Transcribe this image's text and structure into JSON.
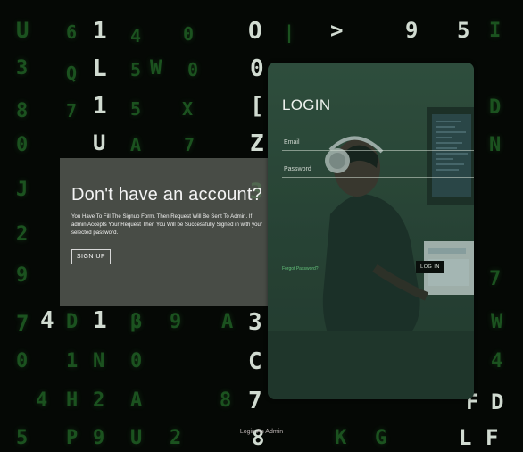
{
  "promo": {
    "heading": "Don't have an account?",
    "description": "You Have To Fill The Signup Form. Then Request Will Be Sent To Admin. If admin Accepts Your Request Then You Will be Successfully Signed in with your selected password.",
    "signup_label": "SIGN UP"
  },
  "login": {
    "title": "LOGIN",
    "email_placeholder": "Email",
    "password_placeholder": "Password",
    "forgot_label": "Forgot Password?",
    "login_label": "LOG IN"
  },
  "footer": {
    "admin_label": "Login As Admin"
  },
  "background": {
    "glyphs": [
      "U",
      "6",
      "1",
      "4",
      "0",
      "O",
      "|",
      ">",
      "9",
      "5",
      "I",
      "3",
      "Q",
      "L",
      "5",
      "W",
      "0",
      "0",
      "8",
      "7",
      "1",
      "5",
      "X",
      "[",
      "D",
      "0",
      "U",
      "A",
      "7",
      "Z",
      "J",
      "3",
      "2",
      "9",
      "7",
      "4",
      "D",
      "1",
      "β",
      "9",
      "A",
      "3",
      "W",
      "0",
      "1",
      "N",
      "0",
      "C",
      "4",
      "4",
      "H",
      "2",
      "A",
      "8",
      "7",
      "F",
      "D",
      "5",
      "P",
      "9",
      "U",
      "2",
      "8",
      "K",
      "G",
      "L",
      "F",
      "N",
      "7"
    ]
  },
  "colors": {
    "matrix_green": "#2d8f35",
    "accent_green": "#63c07a",
    "card": "#2f4a3b"
  }
}
